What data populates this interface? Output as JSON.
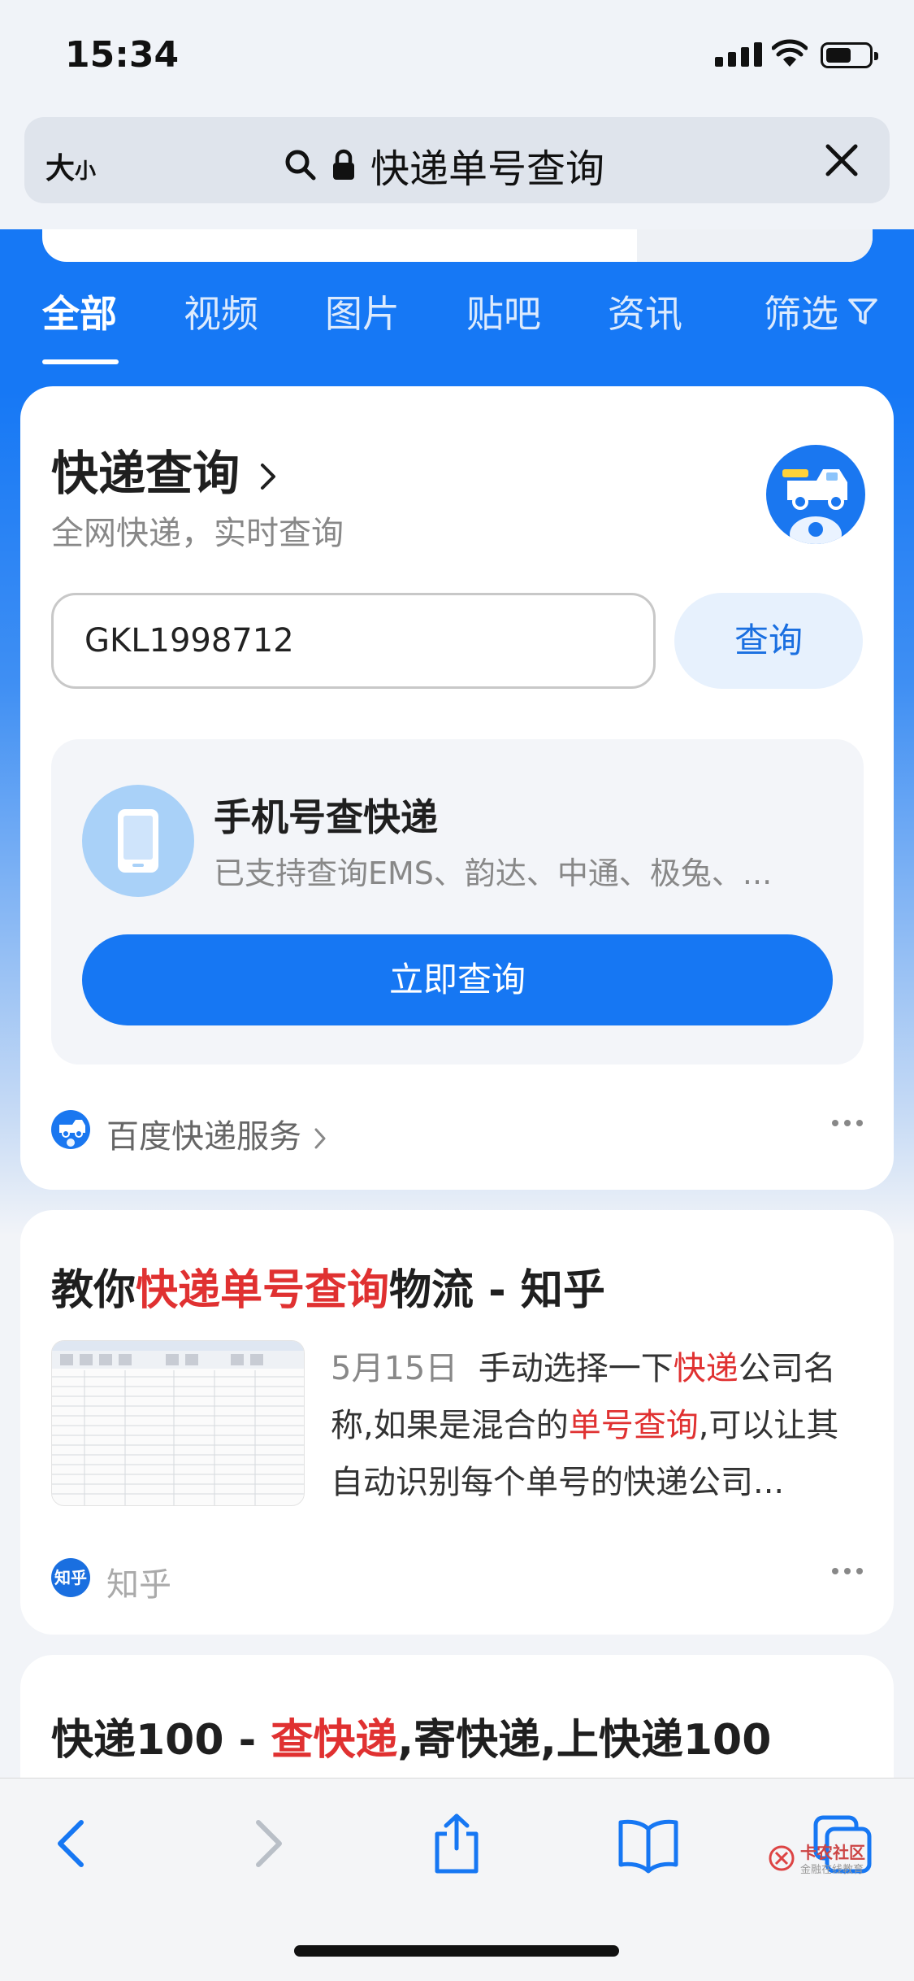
{
  "status_bar": {
    "time": "15:34"
  },
  "browser": {
    "text_size_label": "大",
    "text_size_small": "小",
    "address_text": "快递单号查询"
  },
  "tabs": [
    {
      "label": "全部",
      "active": true
    },
    {
      "label": "视频"
    },
    {
      "label": "图片"
    },
    {
      "label": "贴吧"
    },
    {
      "label": "资讯"
    },
    {
      "label": "筛选"
    }
  ],
  "express_card": {
    "title": "快递查询",
    "subtitle": "全网快递，实时查询",
    "tracking_number": "GKL1998712",
    "query_button": "查询",
    "phone_section": {
      "title": "手机号查快递",
      "description": "已支持查询EMS、韵达、中通、极兔、...",
      "button": "立即查询"
    },
    "service_name": "百度快递服务"
  },
  "result1": {
    "title_pre": "教你",
    "title_highlight": "快递单号查询",
    "title_post": "物流 - 知乎",
    "date": "5月15日",
    "snippet_a": "手动选择一下",
    "snippet_hl1": "快递",
    "snippet_b": "公司名称,如果是混合的",
    "snippet_hl2": "单号查询",
    "snippet_c": ",可以让其自动识别每个单号的快递公司...",
    "source_logo": "知乎",
    "source": "知乎"
  },
  "result2": {
    "title_pre": "快递100 - ",
    "title_highlight": "查快递",
    "title_post": ",寄快递,上快递100"
  },
  "watermark": {
    "text": "卡农社区",
    "sub": "金融在线教育"
  },
  "colors": {
    "brand_blue": "#1677f3",
    "highlight_red": "#e03131"
  }
}
